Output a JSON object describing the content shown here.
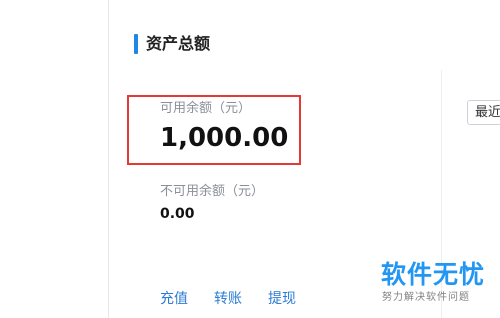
{
  "section": {
    "title": "资产总额"
  },
  "available": {
    "label": "可用余额（元）",
    "value": "1,000.00"
  },
  "unavailable": {
    "label": "不可用余额（元）",
    "value": "0.00"
  },
  "actions": {
    "recharge": "充值",
    "transfer": "转账",
    "withdraw": "提现"
  },
  "filter": {
    "selected": "最近"
  },
  "watermark": {
    "title": "软件无忧",
    "subtitle": "努力解决软件问题"
  },
  "colors": {
    "accent": "#1e88e5",
    "highlight": "#e53935",
    "link": "#2b7cd3"
  }
}
